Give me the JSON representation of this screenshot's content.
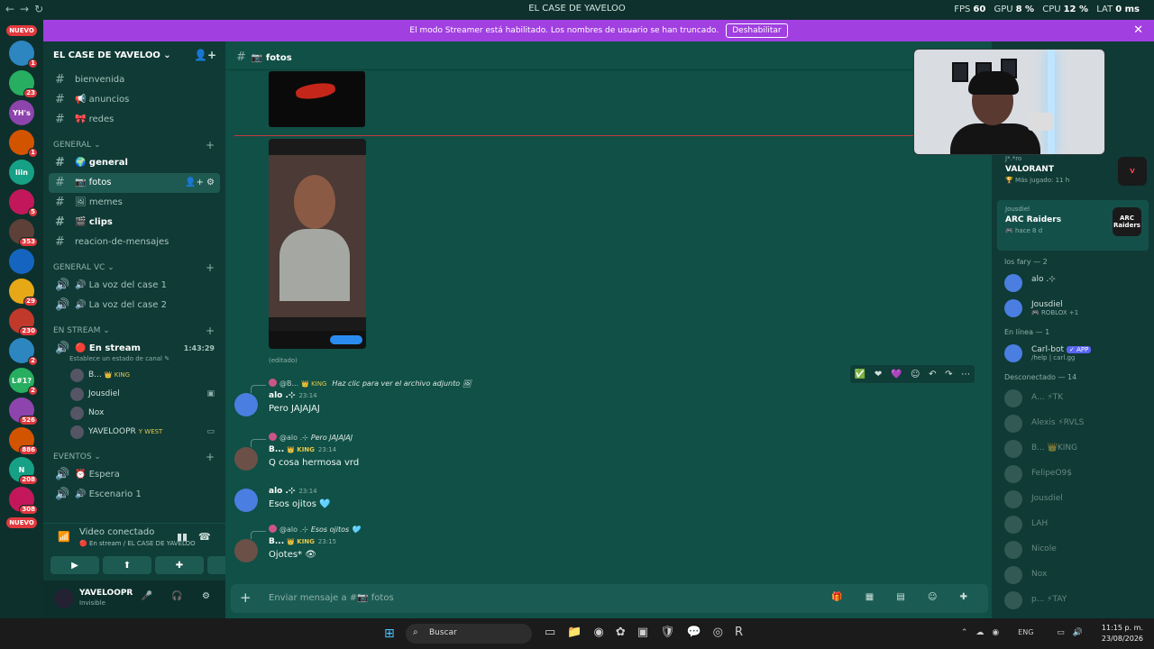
{
  "window": {
    "title": "EL CASE DE YAVELOO",
    "nav": "←→↻",
    "fps_label": "FPS",
    "fps": "60",
    "gpu_label": "GPU",
    "gpu": "8 %",
    "cpu_label": "CPU",
    "cpu": "12 %",
    "lat_label": "LAT",
    "lat": "0 ms"
  },
  "servers": [
    {
      "label": "NUEVO",
      "pill": true
    },
    {
      "label": "",
      "badge": "1"
    },
    {
      "label": "",
      "badge": "23"
    },
    {
      "label": "YH's",
      "badge": ""
    },
    {
      "label": "",
      "badge": "1"
    },
    {
      "label": "liin",
      "badge": ""
    },
    {
      "label": "",
      "badge": "5"
    },
    {
      "label": "",
      "badge": "353"
    },
    {
      "label": "",
      "badge": ""
    },
    {
      "label": "",
      "badge": "29"
    },
    {
      "label": "",
      "badge": "230"
    },
    {
      "label": "",
      "badge": "2"
    },
    {
      "label": "L#1?",
      "badge": "2"
    },
    {
      "label": "",
      "badge": "526"
    },
    {
      "label": "",
      "badge": "886"
    },
    {
      "label": "N",
      "badge": "208"
    },
    {
      "label": "",
      "badge": "308"
    },
    {
      "label": "NUEVO",
      "pill": true
    }
  ],
  "banner": {
    "text": "El modo Streamer está habilitado. Los nombres de usuario se han truncado.",
    "button": "Deshabilitar",
    "close": "✕"
  },
  "guild": {
    "name": "EL CASE DE YAVELOO ⌄",
    "invite_icon": "👤+"
  },
  "channels": {
    "top": [
      {
        "name": "bienvenida"
      },
      {
        "name": "📢 anuncios"
      },
      {
        "name": "🎀 redes"
      }
    ],
    "cat_general": "GENERAL ⌄",
    "general": [
      {
        "name": "🌍 general",
        "bold": true
      },
      {
        "name": "📷 fotos",
        "active": true,
        "tools": "👤+ ⚙"
      },
      {
        "name": "🖼 memes"
      },
      {
        "name": "🎬 clips",
        "bold": true
      },
      {
        "name": "reacion-de-mensajes"
      }
    ],
    "cat_vc": "GENERAL VC ⌄",
    "vc": [
      {
        "name": "🔊 La voz del case 1"
      },
      {
        "name": "🔊 La voz del case 2"
      }
    ],
    "cat_stream": "EN STREAM ⌄",
    "stream": {
      "name": "🔴 En stream",
      "time": "1:43:29",
      "sub": "Establece un estado de canal ✎"
    },
    "voice_users": [
      {
        "name": "B...",
        "tag": "👑 KING",
        "right": ""
      },
      {
        "name": "Jousdiel",
        "tag": "",
        "right": "▣"
      },
      {
        "name": "Nox",
        "tag": "",
        "right": ""
      },
      {
        "name": "YAVELOOPR",
        "tag": "Y WEST",
        "right": "▭"
      }
    ],
    "cat_eventos": "EVENTOS ⌄",
    "eventos": [
      {
        "name": "⏰ Espera"
      },
      {
        "name": "🔊 Escenario 1"
      }
    ]
  },
  "voice": {
    "title": "Video conectado",
    "sub": "🔴 En stream / EL CASE DE YAVELOO",
    "btns": [
      "▶",
      "⬆",
      "✚",
      "✨"
    ]
  },
  "user": {
    "name": "YAVELOOPR",
    "status": "Invisible",
    "icons": "🎤 🎧 ⚙"
  },
  "chat": {
    "channel": "📷 fotos",
    "edited": "(editado)",
    "tools": [
      "✅",
      "❤",
      "💜",
      "☺",
      "↶",
      "↷",
      "⋯"
    ],
    "messages": [
      {
        "reply_user": "@B...",
        "reply_tag": "👑 KING",
        "reply_text": "Haz clic para ver el archivo adjunto 🖼",
        "author": "alo .⊹",
        "tag": "",
        "time": "23:14",
        "text": "Pero JAJAJAJ",
        "av": "a"
      },
      {
        "reply_user": "@alo .⊹",
        "reply_tag": "",
        "reply_text": "Pero JAJAJAJ",
        "author": "B...",
        "tag": "👑 KING",
        "time": "23:14",
        "text": "Q cosa hermosa vrd",
        "av": "b"
      },
      {
        "reply_user": "",
        "reply_tag": "",
        "reply_text": "",
        "author": "alo .⊹",
        "tag": "",
        "time": "23:14",
        "text": "Esos ojitos 🩵",
        "av": "a"
      },
      {
        "reply_user": "@alo .⊹",
        "reply_tag": "",
        "reply_text": "Esos ojitos 🩵",
        "author": "B...",
        "tag": "👑 KING",
        "time": "23:15",
        "text": "Ojotes* 👁",
        "av": "b"
      }
    ],
    "composer_placeholder": "Enviar mensaje a #📷 fotos",
    "composer_icons": "🎁 ▦ ▤ ☺ ✚"
  },
  "members": {
    "activities": [
      {
        "label": "J*.*ro",
        "name": "VALORANT",
        "sub": "🏆 Más jugado: 11 h",
        "logo": "V",
        "hl": false
      },
      {
        "label": "Jousdiel",
        "name": "ARC Raiders",
        "sub": "🎮 hace 8 d",
        "logo": "ARC Raiders",
        "hl": true
      }
    ],
    "group_fary": "los fary — 2",
    "fary": [
      {
        "name": "alo .⊹",
        "sub": ""
      },
      {
        "name": "Jousdiel",
        "sub": "🎮 ROBLOX +1"
      }
    ],
    "group_online": "En línea — 1",
    "online": [
      {
        "name": "Carl-bot",
        "app": "✓ APP",
        "sub": "/help | carl.gg"
      }
    ],
    "group_offline": "Desconectado — 14",
    "offline": [
      {
        "name": "A... ⚡TK"
      },
      {
        "name": "Alexis ⚡RVLS"
      },
      {
        "name": "B... 👑KING"
      },
      {
        "name": "FelipeO9$"
      },
      {
        "name": "Jousdiel"
      },
      {
        "name": "LAH"
      },
      {
        "name": "Nicole"
      },
      {
        "name": "Nox"
      },
      {
        "name": "p... ⚡TAY"
      }
    ]
  },
  "taskbar": {
    "start": "⊞",
    "search": "Buscar",
    "search_icon": "⌕",
    "apps": "▭📁◉✿▣🛡💬◎R",
    "tray": "⌃☁◉",
    "lang": "ENG",
    "tray2": "▭🔊",
    "time": "11:15 p. m.",
    "date": "23/08/2026"
  }
}
